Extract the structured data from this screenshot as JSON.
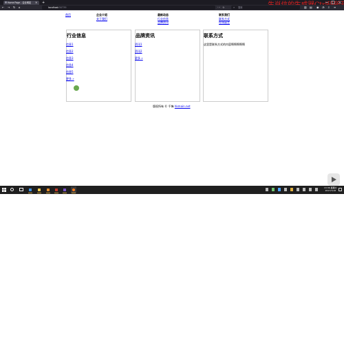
{
  "browser": {
    "tab_title": "Home Page - 企业网站",
    "tab_close": "×",
    "new_tab": "+",
    "url_host": "localhost",
    "url_port": ":50739",
    "search_placeholder": "搜索",
    "overlay_watermark": "生肖信的生成器Ctrl码所开",
    "nav_back": "←",
    "nav_forward": "→",
    "nav_reload": "↻",
    "nav_home": "⌂",
    "menu": "≡"
  },
  "page": {
    "nav": {
      "home": "首页",
      "col1": {
        "heading": "企业介绍",
        "links": [
          "关于我们"
        ]
      },
      "col2": {
        "heading": "最新动态",
        "links": [
          "行业信息",
          "品牌资讯"
        ]
      },
      "col3": {
        "heading": "联系我们",
        "links": [
          "联系方式",
          "在线留言"
        ]
      }
    },
    "boxes": {
      "industry": {
        "title": "行业信息",
        "items": [
          "信息1",
          "信息2",
          "信息3",
          "信息4",
          "信息5"
        ],
        "more": "更多 »"
      },
      "brand": {
        "title": "品牌资讯",
        "items": [
          "资讯1",
          "资讯2"
        ],
        "more": "更多 »"
      },
      "contact": {
        "title": "联系方式",
        "text": "这里是联系方式的内容啊啊啊啊啊"
      }
    },
    "footer": {
      "text": "版权所有 © 千锋 ",
      "link": "hkmain.net"
    }
  },
  "taskbar": {
    "clock_time": "13:36 星期六",
    "clock_date": "2017/7/18"
  },
  "colors": {
    "link": "#0000ee",
    "border": "#cccccc",
    "chrome_dark": "#1c1b22",
    "watermark": "#d42020",
    "taskbar": "#1f1f1f"
  }
}
